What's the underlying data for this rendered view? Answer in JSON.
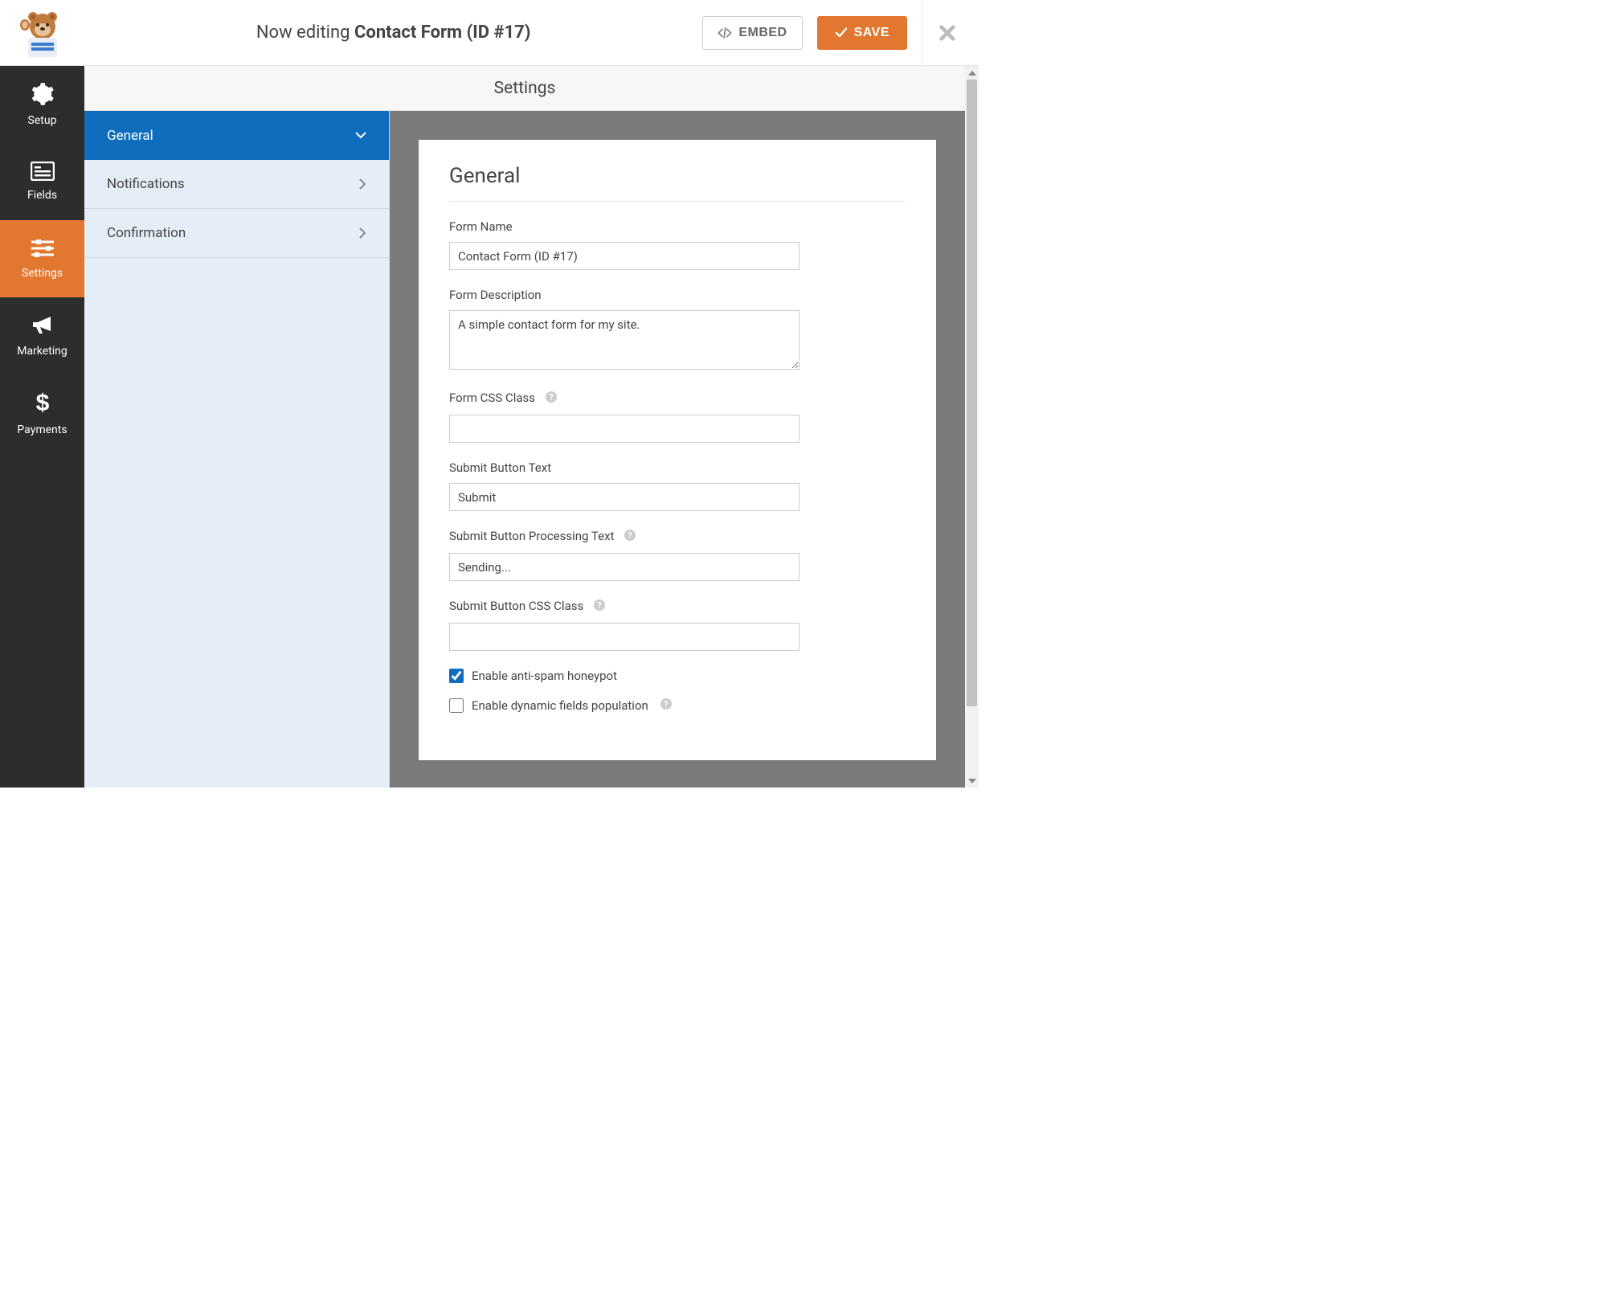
{
  "header": {
    "now_editing_prefix": "Now editing ",
    "form_title": "Contact Form (ID #17)",
    "embed_label": "EMBED",
    "save_label": "SAVE"
  },
  "nav": {
    "items": [
      {
        "label": "Setup"
      },
      {
        "label": "Fields"
      },
      {
        "label": "Settings"
      },
      {
        "label": "Marketing"
      },
      {
        "label": "Payments"
      }
    ]
  },
  "section_title": "Settings",
  "tabs": {
    "items": [
      {
        "label": "General"
      },
      {
        "label": "Notifications"
      },
      {
        "label": "Confirmation"
      }
    ]
  },
  "panel": {
    "heading": "General",
    "form_name_label": "Form Name",
    "form_name_value": "Contact Form (ID #17)",
    "form_desc_label": "Form Description",
    "form_desc_value": "A simple contact form for my site.",
    "form_css_label": "Form CSS Class",
    "form_css_value": "",
    "submit_text_label": "Submit Button Text",
    "submit_text_value": "Submit",
    "submit_processing_label": "Submit Button Processing Text",
    "submit_processing_value": "Sending...",
    "submit_css_label": "Submit Button CSS Class",
    "submit_css_value": "",
    "honeypot_label": "Enable anti-spam honeypot",
    "dynamic_label": "Enable dynamic fields population"
  }
}
